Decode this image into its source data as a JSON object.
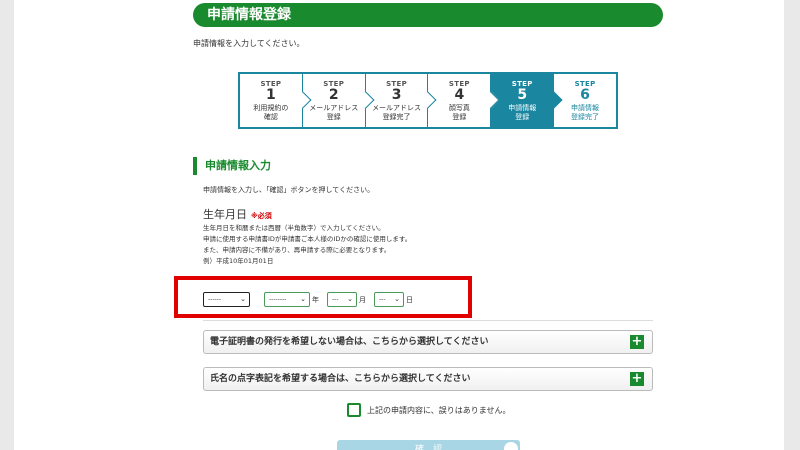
{
  "header": {
    "title": "申請情報登録"
  },
  "intro": "申請情報を入力してください。",
  "steps": [
    {
      "label": "STEP",
      "num": "1",
      "desc1": "利用規約の",
      "desc2": "確認"
    },
    {
      "label": "STEP",
      "num": "2",
      "desc1": "メールアドレス",
      "desc2": "登録"
    },
    {
      "label": "STEP",
      "num": "3",
      "desc1": "メールアドレス",
      "desc2": "登録完了"
    },
    {
      "label": "STEP",
      "num": "4",
      "desc1": "顔写真",
      "desc2": "登録"
    },
    {
      "label": "STEP",
      "num": "5",
      "desc1": "申請情報",
      "desc2": "登録"
    },
    {
      "label": "STEP",
      "num": "6",
      "desc1": "申請情報",
      "desc2": "登録完了"
    }
  ],
  "section": {
    "title": "申請情報入力",
    "desc": "申請情報を入力し、「確認」ボタンを押してください。"
  },
  "birthdate": {
    "label": "生年月日",
    "required": "※必須",
    "help": [
      "生年月日を和暦または西暦（半角数字）で入力してください。",
      "申請に使用する申請書IDが申請書ご本人様のIDかの確認に使用します。",
      "また、申請内容に不備があり、再申請する際に必要となります。",
      "例）平成10年01月01日"
    ],
    "era_value": "------",
    "year_value": "--------",
    "year_unit": "年",
    "month_value": "---",
    "month_unit": "月",
    "day_value": "---",
    "day_unit": "日"
  },
  "accordions": [
    {
      "label": "電子証明書の発行を希望しない場合は、こちらから選択してください"
    },
    {
      "label": "氏名の点字表記を希望する場合は、こちらから選択してください"
    }
  ],
  "agree": {
    "label": "上記の申請内容に、誤りはありません。"
  },
  "confirm": {
    "label": "確　認"
  },
  "icons": {
    "plus": "+",
    "chevron": "⌄"
  },
  "colors": {
    "accent_green": "#1a8a2e",
    "step_teal": "#1a86a0",
    "highlight_red": "#e10000"
  }
}
